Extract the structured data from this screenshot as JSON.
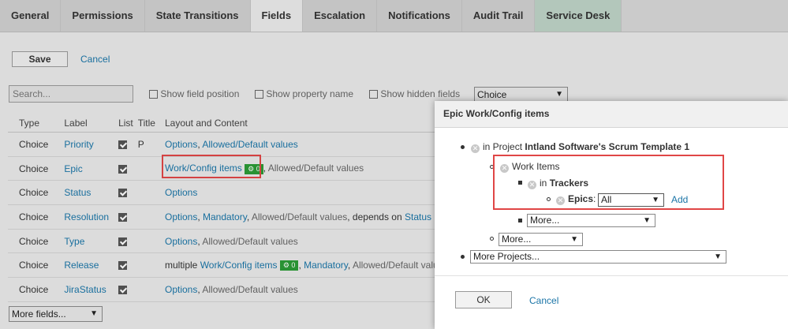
{
  "tabs": [
    {
      "label": "General"
    },
    {
      "label": "Permissions"
    },
    {
      "label": "State Transitions"
    },
    {
      "label": "Fields"
    },
    {
      "label": "Escalation"
    },
    {
      "label": "Notifications"
    },
    {
      "label": "Audit Trail"
    },
    {
      "label": "Service Desk"
    }
  ],
  "toolbar": {
    "save_label": "Save",
    "cancel_label": "Cancel"
  },
  "filters": {
    "search_placeholder": "Search...",
    "show_field_position": "Show field position",
    "show_property_name": "Show property name",
    "show_hidden_fields": "Show hidden fields",
    "type_select_value": "Choice"
  },
  "table": {
    "headers": {
      "type": "Type",
      "label": "Label",
      "list": "List",
      "title": "Title",
      "layout": "Layout and Content"
    },
    "rows": [
      {
        "type": "Choice",
        "label": "Priority",
        "title": "P"
      },
      {
        "type": "Choice",
        "label": "Epic",
        "title": ""
      },
      {
        "type": "Choice",
        "label": "Status",
        "title": ""
      },
      {
        "type": "Choice",
        "label": "Resolution",
        "title": ""
      },
      {
        "type": "Choice",
        "label": "Type",
        "title": ""
      },
      {
        "type": "Choice",
        "label": "Release",
        "title": ""
      },
      {
        "type": "Choice",
        "label": "JiraStatus",
        "title": ""
      }
    ],
    "content": {
      "options": "Options",
      "allowed_default": "Allowed/Default values",
      "work_config": "Work/Config items",
      "mandatory": "Mandatory",
      "depends_on": "depends on",
      "status": "Status",
      "multiple": "multiple",
      "badge_value": "0",
      "sep": ", "
    }
  },
  "more_fields": "More fields...",
  "dialog": {
    "title": "Epic Work/Config items",
    "in_project": "in Project",
    "project_name": "Intland Software's Scrum Template 1",
    "work_items": "Work Items",
    "in": "in",
    "trackers": "Trackers",
    "epics": "Epics",
    "colon": ":",
    "epics_value": "All",
    "add": "Add",
    "more": "More...",
    "more_projects": "More Projects...",
    "ok": "OK",
    "cancel": "Cancel"
  },
  "colors": {
    "link": "#1b75a7",
    "highlight": "#e04646",
    "badge": "#2c9a36"
  }
}
